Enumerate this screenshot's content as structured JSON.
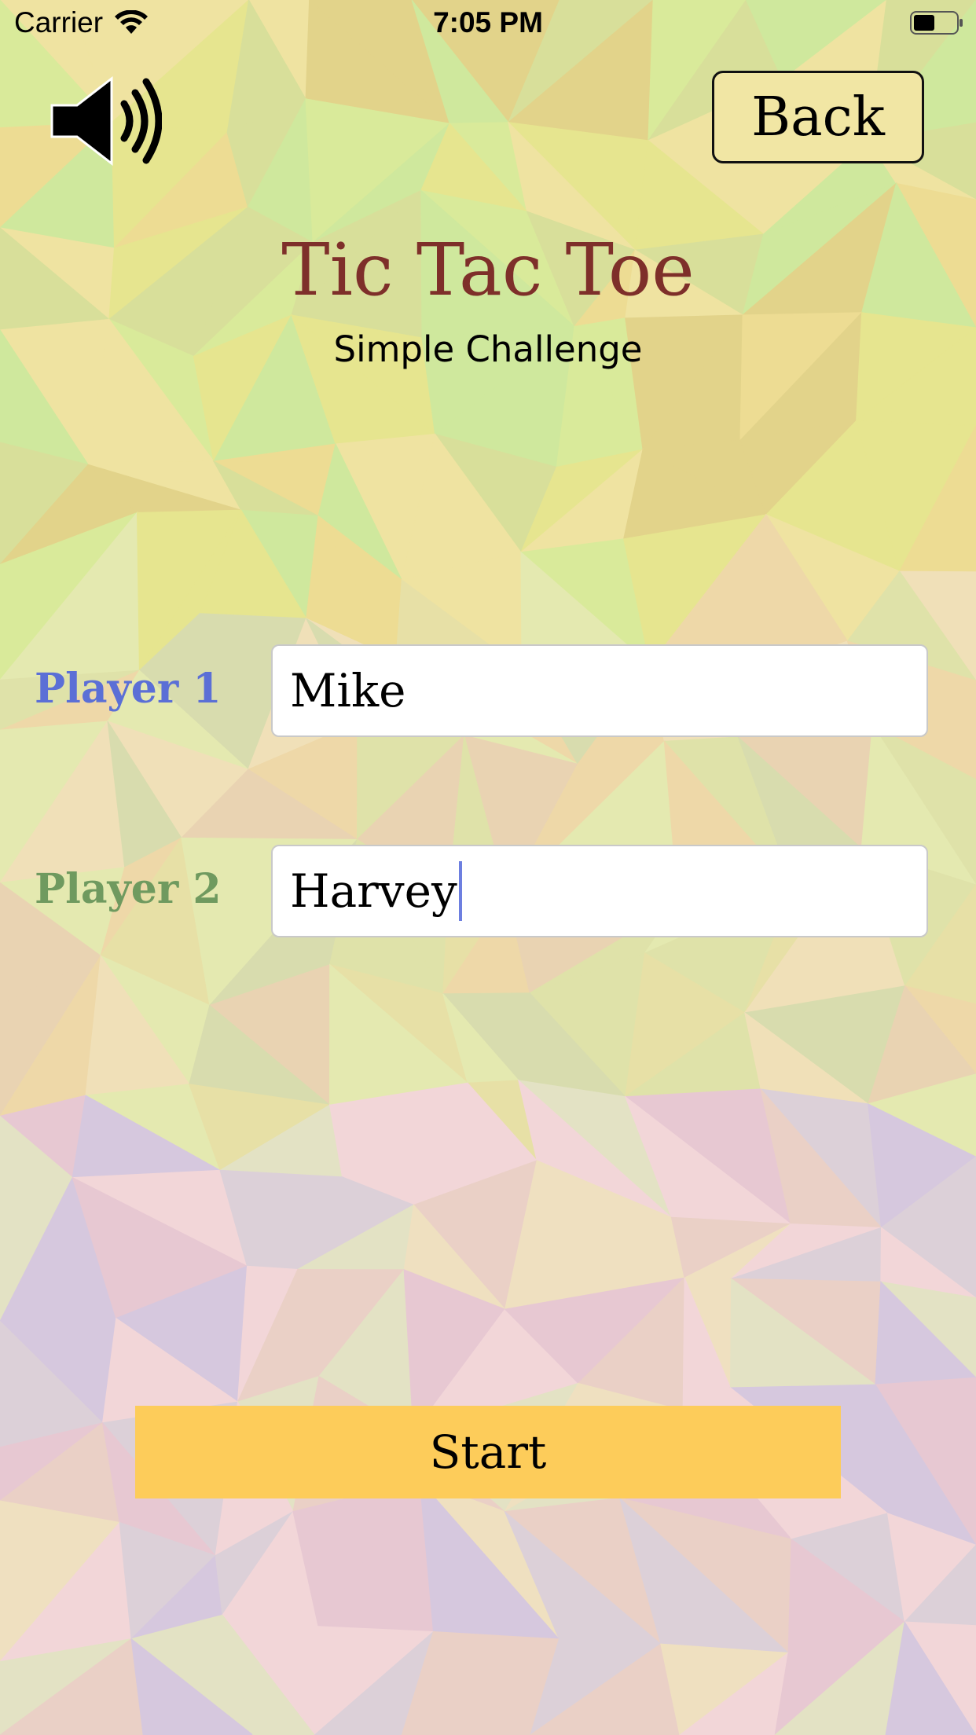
{
  "status_bar": {
    "carrier": "Carrier",
    "time": "7:05 PM"
  },
  "header": {
    "back_label": "Back"
  },
  "title": "Tic Tac Toe",
  "subtitle": "Simple Challenge",
  "players": [
    {
      "label": "Player 1",
      "value": "Mike",
      "color": "#5b6fd6"
    },
    {
      "label": "Player 2",
      "value": "Harvey",
      "color": "#6f9a5f"
    }
  ],
  "start_label": "Start",
  "colors": {
    "title": "#7e2f2a",
    "start_button": "#fdcc5a",
    "back_button": "#f1e6a4"
  },
  "icons": {
    "sound": "speaker-volume-icon",
    "wifi": "wifi-icon",
    "battery": "battery-icon"
  }
}
